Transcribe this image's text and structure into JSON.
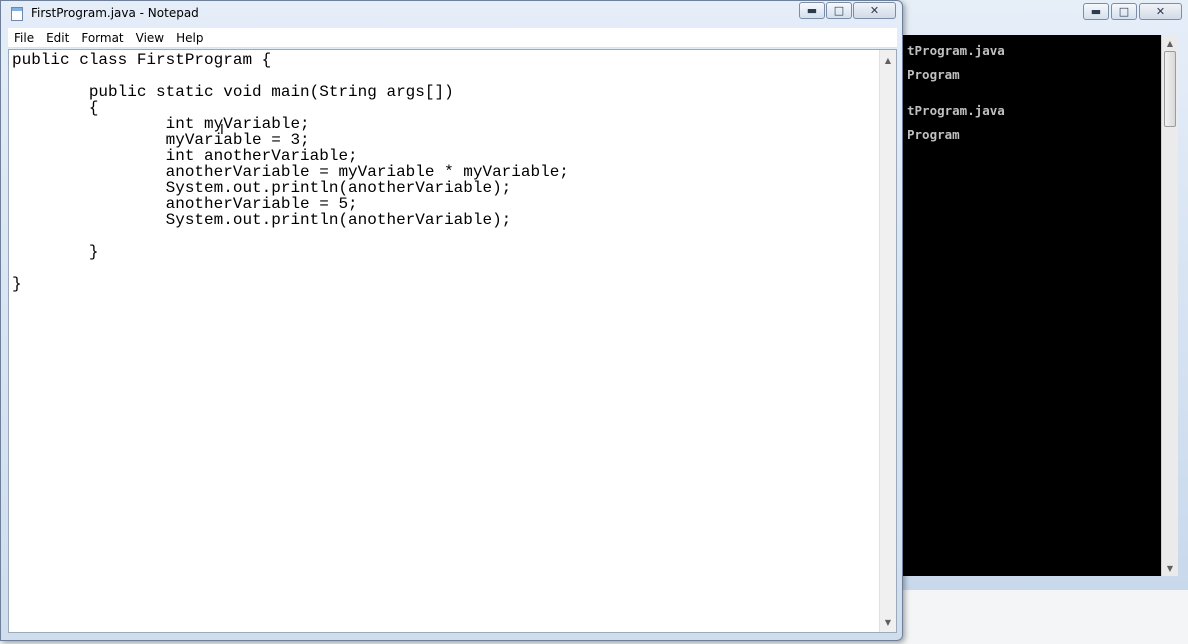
{
  "notepad": {
    "title": "FirstProgram.java - Notepad",
    "window_controls": {
      "minimize": "▬",
      "maximize": "□",
      "close": "✕"
    },
    "menu": [
      {
        "label": "File"
      },
      {
        "label": "Edit"
      },
      {
        "label": "Format"
      },
      {
        "label": "View"
      },
      {
        "label": "Help"
      }
    ],
    "code": "public class FirstProgram {\n\n        public static void main(String args[])\n        {\n                int myVariable;\n                myVariable = 3;\n                int anotherVariable;\n                anotherVariable = myVariable * myVariable;\n                System.out.println(anotherVariable);\n                anotherVariable = 5;\n                System.out.println(anotherVariable);\n\n        }\n\n}"
  },
  "console": {
    "window_controls": {
      "minimize": "▬",
      "maximize": "□",
      "close": "✕"
    },
    "lines": [
      {
        "text": "tProgram.java"
      },
      {
        "text": "Program"
      },
      {
        "text": "tProgram.java"
      },
      {
        "text": "Program"
      }
    ]
  },
  "colors": {
    "console_background": "#000000",
    "console_text": "#c0c0c0",
    "editor_background": "#ffffff",
    "frame": "#cfdded"
  },
  "icons": [
    "notepad-app-icon",
    "minimize-icon",
    "maximize-icon",
    "close-icon",
    "text-cursor-icon"
  ]
}
